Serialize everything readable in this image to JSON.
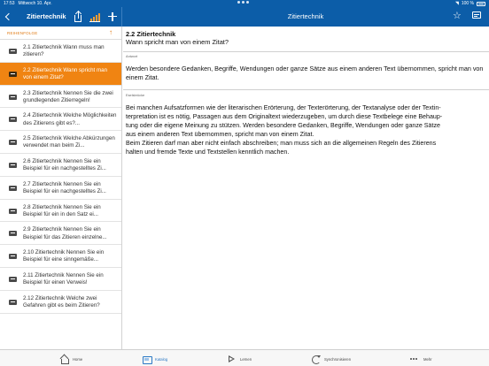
{
  "status_bar": {
    "time": "17:53",
    "date": "Mittwoch 10. Apr.",
    "battery": "100 %"
  },
  "nav": {
    "left_title": "Zitiertechnik",
    "center_title": "Zitiertechnik",
    "icons": [
      "back-chevron-icon",
      "share-icon",
      "bar-chart-icon",
      "plus-icon",
      "star-icon",
      "edit-card-icon"
    ],
    "accent_color": "#0c5da8",
    "chart_icon_color": "#f39c32"
  },
  "sidebar": {
    "sort_label": "REIHENFOLGE",
    "sort_icon": "up-arrow-icon",
    "highlight_color": "#f08412",
    "items": [
      {
        "label": "2.1 Zitiertechnik Wann muss man zitieren?",
        "active": false
      },
      {
        "label": "2.2 Zitiertechnik Wann spricht man von einem Zitat?",
        "active": true
      },
      {
        "label": "2.3 Zitiertechnik Nennen Sie die zwei grundlegenden Zitierregeln!",
        "active": false
      },
      {
        "label": "2.4 Zitiertechnik Welche Möglichkeiten des Zitierens gibt es?...",
        "active": false
      },
      {
        "label": "2.5 Zitiertechnik Welche Abkürzungen verwendet man beim Zi...",
        "active": false
      },
      {
        "label": "2.6 Zitiertechnik Nennen Sie ein Beispiel für ein nachgestelltes Zi...",
        "active": false
      },
      {
        "label": "2.7 Zitiertechnik Nennen Sie ein Beispiel für ein nachgestelltes Zi...",
        "active": false
      },
      {
        "label": "2.8 Zitiertechnik Nennen Sie ein Beispiel für ein in den Satz ei...",
        "active": false
      },
      {
        "label": "2.9 Zitiertechnik Nennen Sie ein Beispiel für das Zitieren einzelne...",
        "active": false
      },
      {
        "label": "2.10 Zitiertechnik Nennen Sie ein Beispiel für eine sinngemäße...",
        "active": false
      },
      {
        "label": "2.11 Zitiertechnik Nennen Sie ein Beispiel für einen Verweis!",
        "active": false
      },
      {
        "label": "2.12 Zitiertechnik Welche zwei Gefahren gibt es beim Zitieren?",
        "active": false
      }
    ]
  },
  "main": {
    "question_title": "2.2 Zitiertechnik",
    "question_text": "Wann spricht man von einem Zitat?",
    "answer_label": "Antwort",
    "answer_text": "Werden besondere Gedanken, Begriffe, Wendungen oder ganze Sätze aus einem anderen Text übernommen, spricht man von einem Zitat.",
    "example_label": "Eselsbrücke",
    "example_lines": [
      "Bei manchen Aufsatzformen wie der literarischen Erörterung, der Texterörterung, der Textanalyse oder der Textin-",
      "terpretation ist es nötig, Passagen aus dem Originaltext wiederzugeben, um durch diese Textbelege eine Behaup-",
      "tung oder die eigene Meinung zu stützen. Werden besondere Gedanken, Begriffe, Wendungen oder ganze Sätze",
      "aus einem anderen Text übernommen, spricht man von einem Zitat.",
      "Beim Zitieren darf man aber nicht einfach abschreiben; man muss sich an die allgemeinen Regeln des Zitierens",
      "halten und fremde Texte und Textstellen kenntlich machen."
    ]
  },
  "tabbar": {
    "tabs": [
      {
        "label": "Home",
        "icon": "home-icon",
        "active": false
      },
      {
        "label": "Katalog",
        "icon": "catalog-icon",
        "active": true
      },
      {
        "label": "Lernen",
        "icon": "play-icon",
        "active": false
      },
      {
        "label": "Synchronisieren",
        "icon": "sync-icon",
        "active": false
      },
      {
        "label": "Mehr",
        "icon": "more-dots-icon",
        "active": false
      }
    ]
  }
}
